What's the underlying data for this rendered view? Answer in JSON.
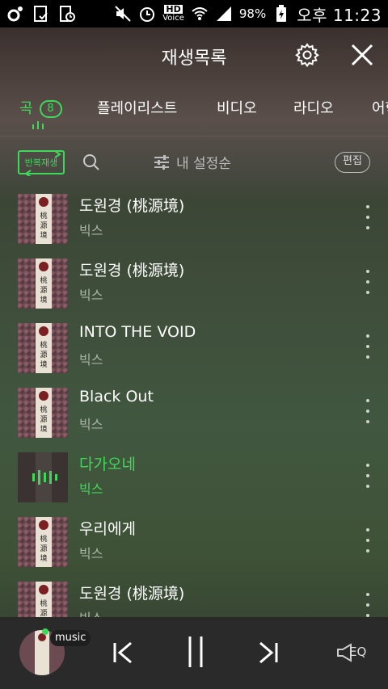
{
  "status_bar": {
    "hd_label": "HD",
    "voice_label": "Voice",
    "battery": "98%",
    "time": "오후 11:23"
  },
  "header": {
    "title": "재생목록"
  },
  "tabs": [
    {
      "label": "곡",
      "badge": "8",
      "active": true
    },
    {
      "label": "플레이리스트",
      "active": false
    },
    {
      "label": "비디오",
      "active": false
    },
    {
      "label": "라디오",
      "active": false
    },
    {
      "label": "어학",
      "active": false
    }
  ],
  "toolbar": {
    "repeat_label": "반복재생",
    "sort_label": "내 설정순",
    "edit_label": "편집"
  },
  "album_art_text": "桃源境",
  "songs": [
    {
      "title": "도원경 (桃源境)",
      "artist": "빅스",
      "playing": false
    },
    {
      "title": "도원경 (桃源境)",
      "artist": "빅스",
      "playing": false
    },
    {
      "title": "INTO THE VOID",
      "artist": "빅스",
      "playing": false
    },
    {
      "title": "Black Out",
      "artist": "빅스",
      "playing": false
    },
    {
      "title": "다가오네",
      "artist": "빅스",
      "playing": true
    },
    {
      "title": "우리에게",
      "artist": "빅스",
      "playing": false
    },
    {
      "title": "도원경 (桃源境)",
      "artist": "빅스",
      "playing": false
    }
  ],
  "player": {
    "source_label": "music",
    "eq_label": "EQ"
  },
  "colors": {
    "accent": "#3fd85a",
    "player_bg": "#2b2a2b",
    "status_bg": "#000000"
  }
}
